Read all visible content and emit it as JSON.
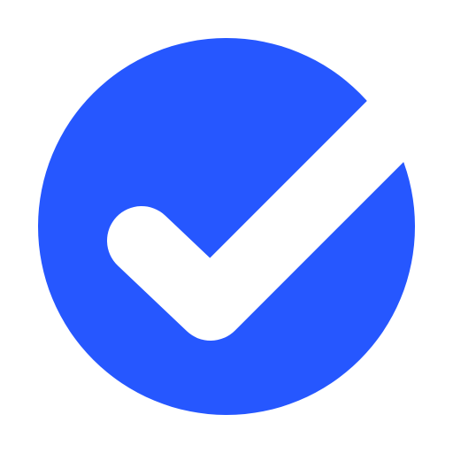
{
  "icon": {
    "name": "check-circle-icon",
    "circle_color": "#2657FF",
    "check_color": "#FFFFFF",
    "background_color": "#FFFFFF"
  }
}
